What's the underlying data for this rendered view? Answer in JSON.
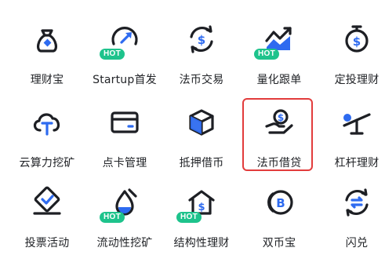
{
  "colors": {
    "accent": "#2e6bf0",
    "hot_badge": "#1ec38c",
    "highlight_border": "#e23c3c",
    "text": "#222428"
  },
  "hot_label": "HOT",
  "items": [
    {
      "label": "理财宝",
      "icon": "money-bag-icon",
      "hot": false
    },
    {
      "label": "Startup首发",
      "icon": "rocket-gauge-icon",
      "hot": true
    },
    {
      "label": "法币交易",
      "icon": "currency-exchange-icon",
      "hot": false
    },
    {
      "label": "量化跟单",
      "icon": "trend-chart-icon",
      "hot": true
    },
    {
      "label": "定投理财",
      "icon": "stopwatch-coin-icon",
      "hot": false
    },
    {
      "label": "云算力挖矿",
      "icon": "cloud-mining-icon",
      "hot": false
    },
    {
      "label": "点卡管理",
      "icon": "point-card-icon",
      "hot": false
    },
    {
      "label": "抵押借币",
      "icon": "collateral-cube-icon",
      "hot": false
    },
    {
      "label": "法币借贷",
      "icon": "fiat-loan-hand-icon",
      "hot": false
    },
    {
      "label": "杠杆理财",
      "icon": "leverage-scale-icon",
      "hot": false
    },
    {
      "label": "投票活动",
      "icon": "vote-ballot-icon",
      "hot": false
    },
    {
      "label": "流动性挖矿",
      "icon": "liquidity-mining-icon",
      "hot": true
    },
    {
      "label": "结构性理财",
      "icon": "structured-house-icon",
      "hot": true
    },
    {
      "label": "双币宝",
      "icon": "dual-coin-icon",
      "hot": false
    },
    {
      "label": "闪兑",
      "icon": "swap-arrows-icon",
      "hot": false
    }
  ]
}
